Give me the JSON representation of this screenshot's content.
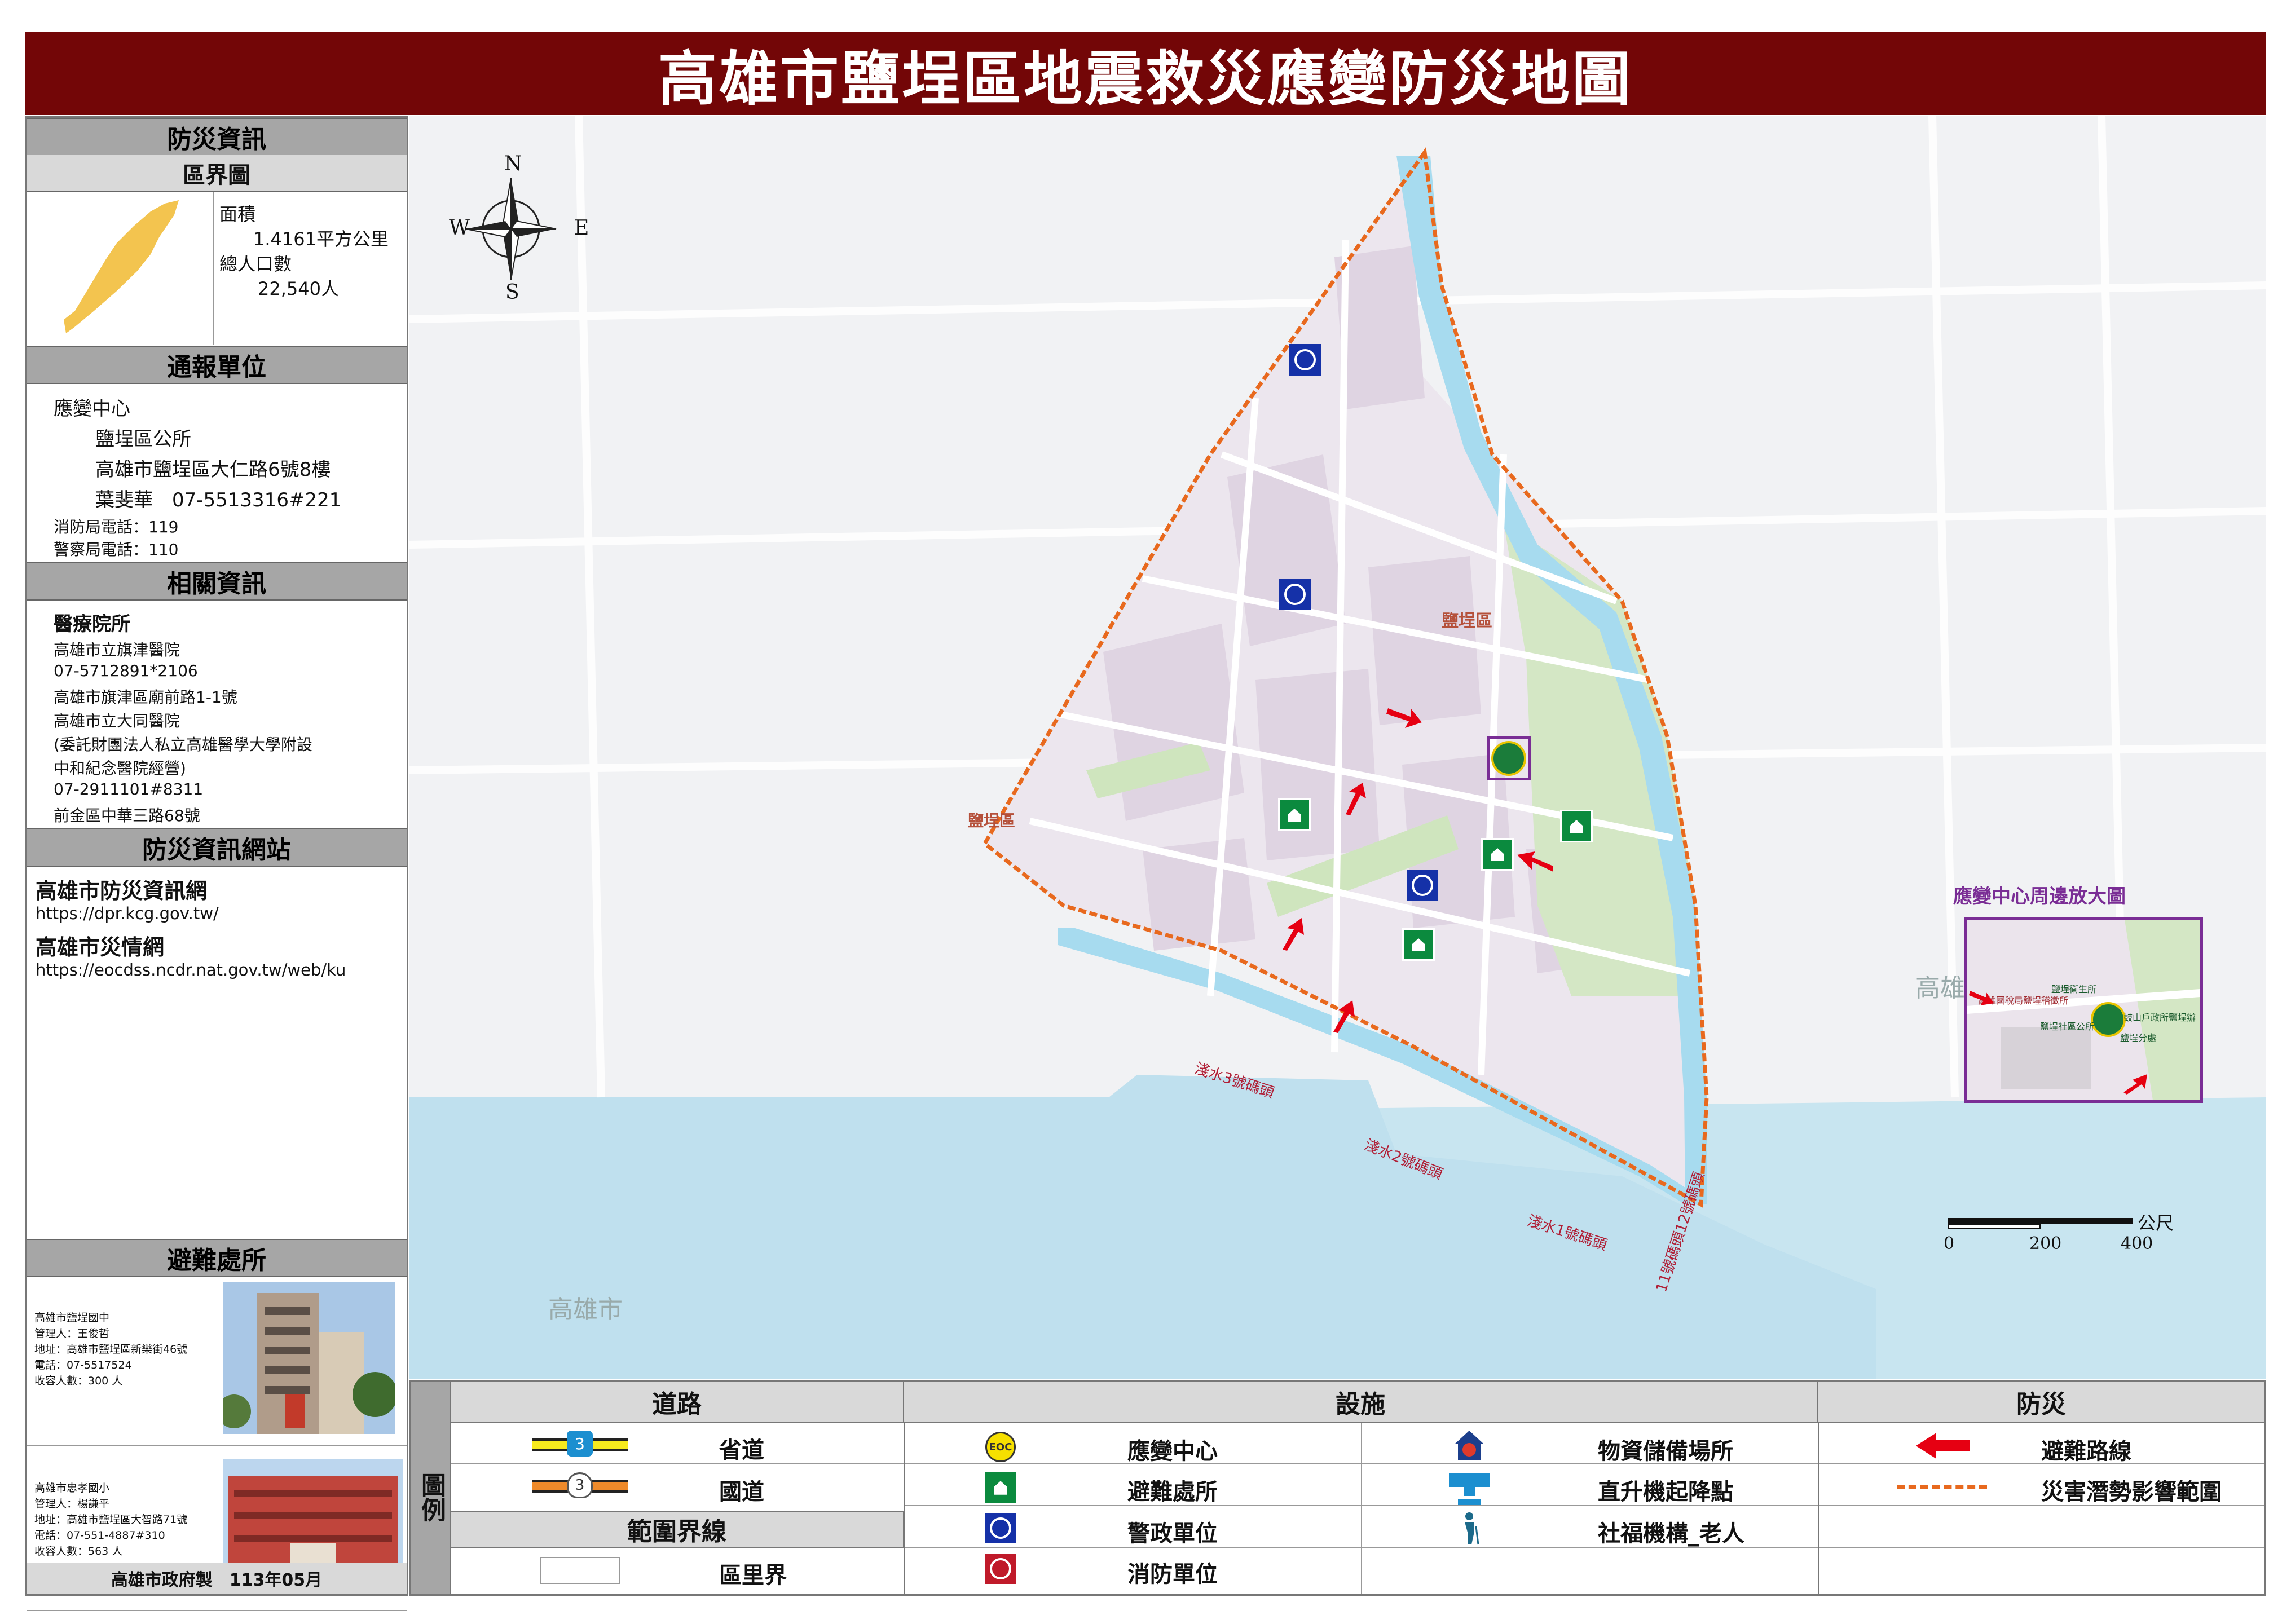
{
  "title": "高雄市鹽埕區地震救災應變防災地圖",
  "panel": {
    "info_header": "防災資訊",
    "district_map_header": "區界圖",
    "area_label": "面積",
    "area_value": "1.4161平方公里",
    "population_label": "總人口數",
    "population_value": "22,540人",
    "report_header": "通報單位",
    "eoc_label": "應變中心",
    "eoc_office": "鹽埕區公所",
    "eoc_address": "高雄市鹽埕區大仁路6號8樓",
    "eoc_contact": "葉斐華　07-5513316#221",
    "fire_phone": "消防局電話：119",
    "police_phone": "警察局電話：110",
    "related_header": "相關資訊",
    "medical_title": "醫療院所",
    "medical_lines": [
      "高雄市立旗津醫院",
      "07-5712891*2106",
      "高雄市旗津區廟前路1-1號",
      "高雄市立大同醫院",
      "(委託財團法人私立高雄醫學大學附設",
      "中和紀念醫院經營)",
      "07-2911101#8311",
      "前金區中華三路68號"
    ],
    "web_header": "防災資訊網站",
    "web1_title": "高雄市防災資訊網",
    "web1_url": "https://dpr.kcg.gov.tw/",
    "web2_title": "高雄市災情網",
    "web2_url": "https://eocdss.ncdr.nat.gov.tw/web/ku",
    "shelter_header": "避難處所",
    "shelters": [
      {
        "lines": [
          "高雄市鹽埕國中",
          "管理人：王俊哲",
          "地址：高雄市鹽埕區新樂街46號",
          "電話：07-5517524",
          "收容人數：300 人"
        ]
      },
      {
        "lines": [
          "高雄市忠孝國小",
          "管理人：楊謙平",
          "地址：高雄市鹽埕區大智路71號",
          "電話：07-551-4887#310",
          "收容人數：563 人"
        ]
      }
    ],
    "footer": "高雄市政府製　113年05月"
  },
  "map": {
    "compass": {
      "n": "N",
      "s": "S",
      "e": "E",
      "w": "W"
    },
    "district_label": "鹽埕區",
    "district_label_2": "鹽埕區",
    "city_label": "高雄市",
    "wharf_labels": [
      "淺水3號碼頭",
      "淺水2號碼頭",
      "淺水1號碼頭",
      "11號碼頭12號碼頭"
    ],
    "inset_title": "應變中心周邊放大圖",
    "inset_labels": [
      "鹽埕衛生所",
      "高雄國稅局鹽埕稽徵所",
      "鹽埕社區公所",
      "鼓山戶政所鹽埕辦",
      "鹽埕分處"
    ],
    "scale_unit": "公尺",
    "scale_ticks": [
      "0",
      "200",
      "400"
    ],
    "neighbor_label": "高雄"
  },
  "legend": {
    "road_header": "道路",
    "facility_header": "設施",
    "disaster_header": "防災",
    "legend_side": "圖例",
    "boundary_header": "範圍界線",
    "road_items": [
      "省道",
      "國道"
    ],
    "boundary_items": [
      "區里界"
    ],
    "facility_items": [
      "應變中心",
      "避難處所",
      "警政單位",
      "消防單位"
    ],
    "facility_items_2": [
      "物資儲備場所",
      "直升機起降點",
      "社福機構_老人"
    ],
    "disaster_items": [
      "避難路線",
      "災害潛勢影響範圍"
    ],
    "shield_number": "3",
    "eoc_badge": "EOC"
  },
  "colors": {
    "title_bg": "#730607",
    "river": "#a8dcef",
    "sea": "#c5e4f0",
    "park": "#d6e9c6",
    "block": "#e5dde6",
    "boundary": "#e8691e",
    "arrow": "#e60012",
    "inset_border": "#7a2d95"
  }
}
